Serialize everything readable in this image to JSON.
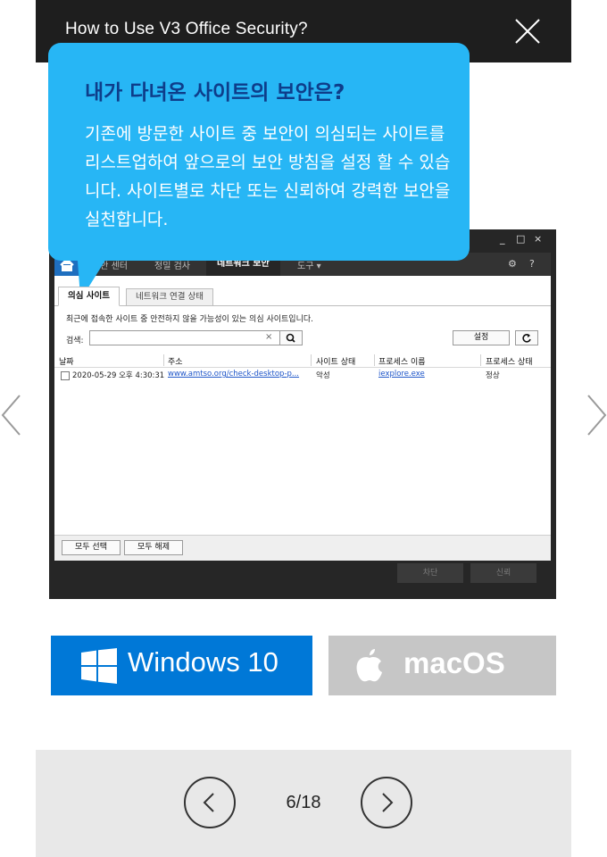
{
  "header": {
    "title": "How to Use V3 Office Security?"
  },
  "callout": {
    "title": "내가 다녀온 사이트의 보안은?",
    "body": "기존에 방문한 사이트 중 보안이 의심되는 사이트를 리스트업하여 앞으로의 보안 방침을 설정 할 수 있습니다. 사이트별로 차단 또는 신뢰하여 강력한 보안을 실천합니다."
  },
  "app": {
    "window_controls": [
      "_",
      "□",
      "×"
    ],
    "menu": {
      "item1": "보안 센터",
      "item2": "정밀 검사",
      "item3": "네트워크 보안",
      "item4": "도구 ▾"
    },
    "tabs": {
      "active": "의심 사이트",
      "inactive": "네트워크 연결 상태"
    },
    "description": "최근에 접속한 사이트 중 안전하지 않을 가능성이 있는 의심 사이트입니다.",
    "search": {
      "label": "검색:",
      "value": "",
      "clear": "×"
    },
    "settings_button": "설정",
    "table": {
      "headers": {
        "date": "날짜",
        "address": "주소",
        "site_status": "사이트 상태",
        "process_name": "프로세스 이름",
        "process_status": "프로세스 상태"
      },
      "rows": [
        {
          "date": "2020-05-29 오후 4:30:31",
          "address": "www.amtso.org/check-desktop-p...",
          "site_status": "악성",
          "process_name": "iexplore.exe",
          "process_status": "정상"
        }
      ]
    },
    "select_all": "모두 선택",
    "deselect_all": "모두 해제",
    "block_button": "차단",
    "trust_button": "신뢰"
  },
  "os_buttons": {
    "windows": "Windows 10",
    "mac": "macOS"
  },
  "pager": {
    "current": 6,
    "total": 18,
    "label": "6/18"
  },
  "colors": {
    "accent": "#27b6f5",
    "windows": "#0078d7",
    "header": "#1e1e1e"
  }
}
